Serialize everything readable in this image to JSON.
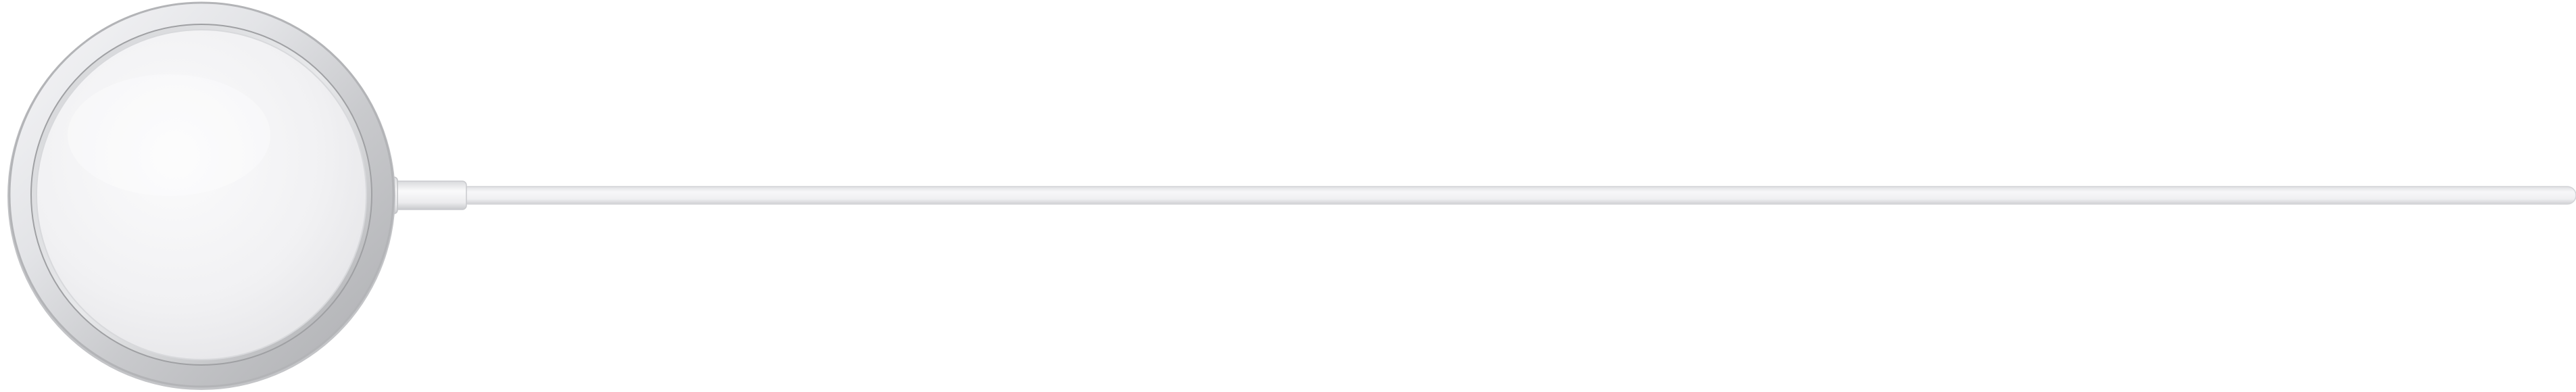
{
  "image": {
    "subject": "magsafe-charger",
    "background_color": "#ffffff",
    "colors": {
      "puck_face": "#f2f2f4",
      "ring_light": "#f4f4f6",
      "ring_dark": "#b9babd",
      "cable": "#f3f3f5",
      "cable_shadow": "#d9dadd",
      "strain_relief": "#e9e9ec"
    }
  }
}
